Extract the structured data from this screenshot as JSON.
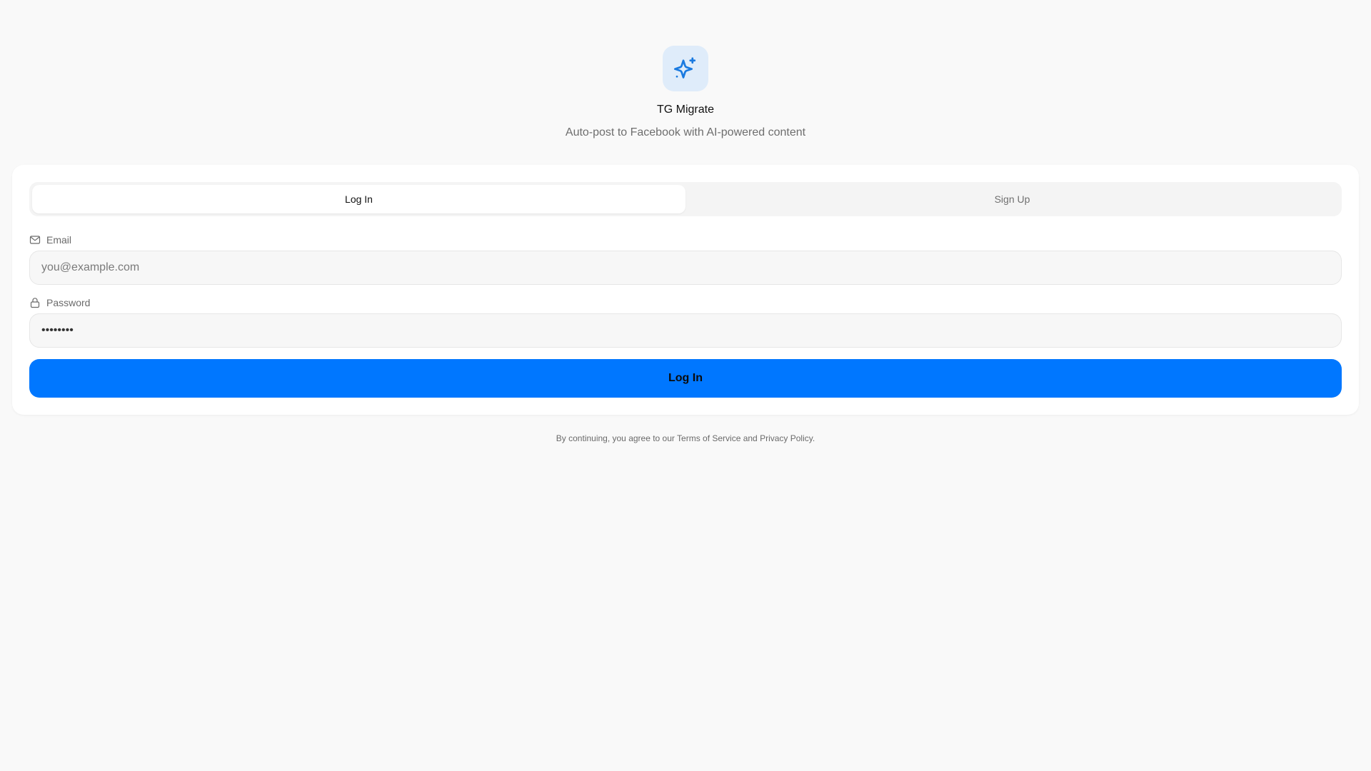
{
  "brand": {
    "logo_icon": "sparkles-icon",
    "title": "TG Migrate",
    "subtitle": "Auto-post to Facebook with AI-powered content",
    "accent_color": "#0077ff",
    "logo_bg_color": "#dfecfa"
  },
  "auth": {
    "tabs": [
      {
        "label": "Log In",
        "active": true
      },
      {
        "label": "Sign Up",
        "active": false
      }
    ],
    "email": {
      "icon": "mail-icon",
      "label": "Email",
      "value": "",
      "placeholder": "you@example.com"
    },
    "password": {
      "icon": "lock-icon",
      "label": "Password",
      "value": "••••••••",
      "placeholder": ""
    },
    "submit_label": "Log In"
  },
  "legal": {
    "text": "By continuing, you agree to our Terms of Service and Privacy Policy."
  }
}
